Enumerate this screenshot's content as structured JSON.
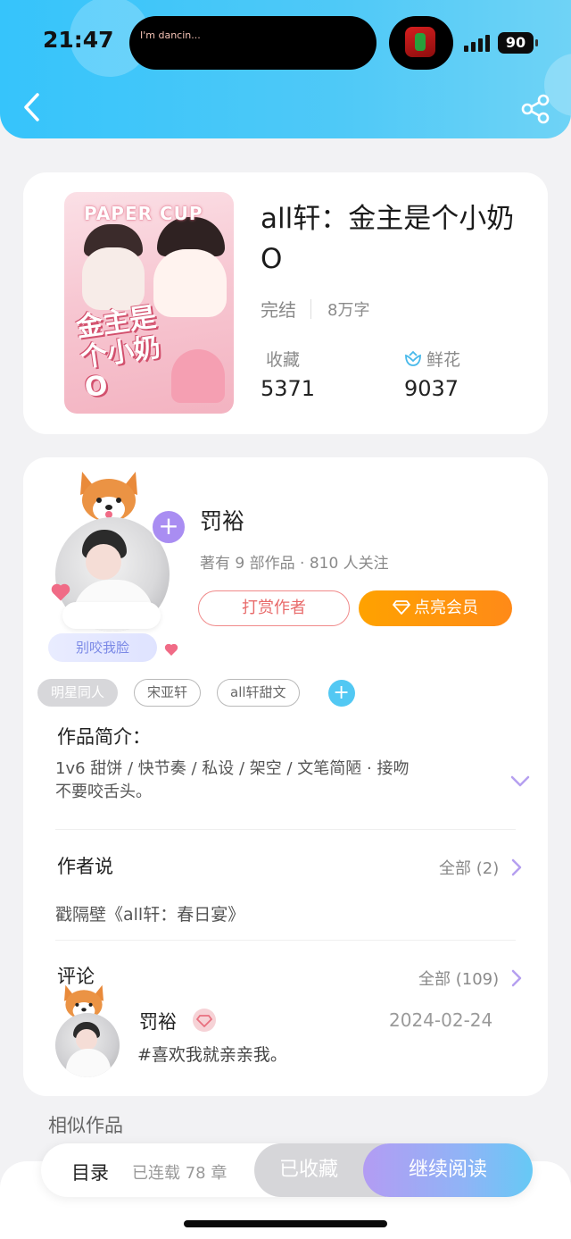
{
  "status_bar": {
    "time": "21:47",
    "now_playing": "I'm dancin...",
    "battery": "90",
    "album_icon": "album-art-icon"
  },
  "nav": {
    "back_icon": "chevron-left-icon",
    "share_icon": "share-icon"
  },
  "book": {
    "cover_text": "PAPER CUP",
    "cover_art_text": "金主是个小奶O",
    "title": "all轩：金主是个小奶O",
    "status": "完结",
    "word_count": "8万字",
    "collect_label": "收藏",
    "collect_count": "5371",
    "flower_label": "鲜花",
    "flower_count": "9037"
  },
  "author": {
    "name": "罚裕",
    "meta": "著有 9 部作品 · 810 人关注",
    "tag": "别咬我脸",
    "follow_symbol": "+",
    "reward_label": "打赏作者",
    "vip_label": "点亮会员"
  },
  "tags": {
    "items": [
      "明星同人",
      "宋亚轩",
      "all轩甜文"
    ],
    "add_symbol": "+"
  },
  "intro": {
    "title": "作品简介：",
    "text": "1v6 甜饼 / 快节奏 / 私设 / 架空 / 文笔简陋 · 接吻不要咬舌头。"
  },
  "author_says": {
    "title": "作者说",
    "more": "全部 (2)",
    "text": "戳隔壁《all轩：春日宴》"
  },
  "comments": {
    "title": "评论",
    "more": "全部 (109)",
    "items": [
      {
        "user": "罚裕",
        "date": "2024-02-24",
        "text": "#喜欢我就亲亲我。"
      }
    ]
  },
  "similar": {
    "title": "相似作品"
  },
  "bottom_bar": {
    "toc_label": "目录",
    "serial_label": "已连载 78 章",
    "collected_label": "已收藏",
    "read_label": "继续阅读"
  },
  "colors": {
    "header": "#36c4fb",
    "vip_orange": "#ff9a0c",
    "reward_red": "#e86a6a",
    "accent_purple": "#a98df2",
    "tag_add_blue": "#52c8f3"
  }
}
